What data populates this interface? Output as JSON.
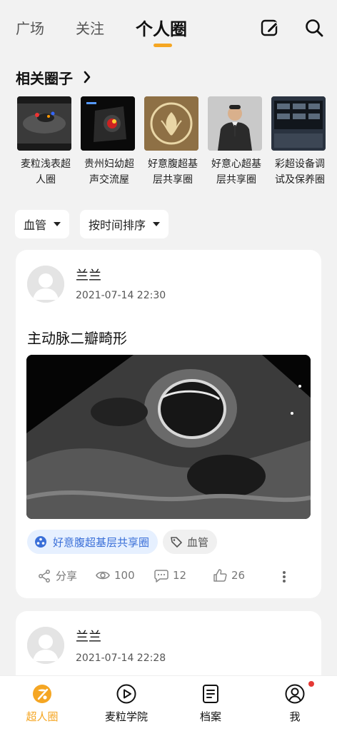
{
  "topnav": {
    "tabs": [
      {
        "label": "广场"
      },
      {
        "label": "关注"
      },
      {
        "label": "个人圈"
      }
    ],
    "active_tab": "个人圈",
    "edit_icon": "edit-icon",
    "search_icon": "search-icon"
  },
  "circles": {
    "title": "相关圈子",
    "items": [
      {
        "name": "麦粒浅表超人圈"
      },
      {
        "name": "贵州妇幼超声交流屋"
      },
      {
        "name": "好意腹超基层共享圈"
      },
      {
        "name": "好意心超基层共享圈"
      },
      {
        "name": "彩超设备调试及保养圈"
      }
    ]
  },
  "filters": {
    "category": "血管",
    "sort": "按时间排序"
  },
  "posts": [
    {
      "username": "兰兰",
      "time": "2021-07-14 22:30",
      "title": "主动脉二瓣畸形",
      "circle_tag": "好意腹超基层共享圈",
      "topic_tag": "血管",
      "share_label": "分享",
      "views": "100",
      "comments": "12",
      "likes": "26"
    },
    {
      "username": "兰兰",
      "time": "2021-07-14 22:28"
    }
  ],
  "bottomnav": {
    "items": [
      {
        "label": "超人圈",
        "icon": "superhuman-circle-icon"
      },
      {
        "label": "麦粒学院",
        "icon": "play-icon"
      },
      {
        "label": "档案",
        "icon": "archive-icon"
      },
      {
        "label": "我",
        "icon": "user-icon"
      }
    ],
    "active": "超人圈"
  },
  "colors": {
    "accent": "#f5a623",
    "tag_blue_bg": "#e6f0ff",
    "tag_blue_text": "#3a6fd8",
    "notification": "#e53935"
  }
}
